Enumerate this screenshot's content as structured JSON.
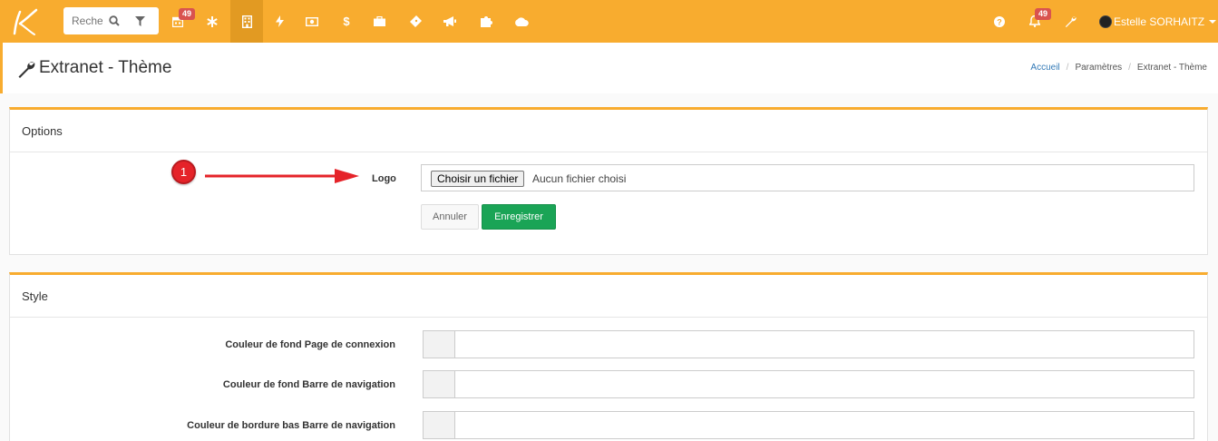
{
  "topbar": {
    "search": {
      "placeholder": "Rechercher"
    },
    "badges": {
      "calendar": "49",
      "notifications": "49"
    },
    "user": {
      "name": "Estelle SORHAITZ"
    },
    "icons": [
      "search-icon",
      "filter-icon",
      "calendar-icon",
      "asterisk-icon",
      "building-icon",
      "bolt-icon",
      "money-icon",
      "dollar-icon",
      "briefcase-icon",
      "ticket-icon",
      "megaphone-icon",
      "puzzle-icon",
      "cloud-icon",
      "help-icon",
      "bell-icon",
      "wrench-icon"
    ]
  },
  "header": {
    "title": "Extranet - Thème",
    "breadcrumb": [
      "Accueil",
      "Paramètres",
      "Extranet - Thème"
    ]
  },
  "options": {
    "heading": "Options",
    "logo_label": "Logo",
    "file_button": "Choisir un fichier",
    "file_status": "Aucun fichier choisi",
    "cancel": "Annuler",
    "save": "Enregistrer"
  },
  "annotation": {
    "marker": "1"
  },
  "style": {
    "heading": "Style",
    "fields": [
      "Couleur de fond Page de connexion",
      "Couleur de fond Barre de navigation",
      "Couleur de bordure bas Barre de navigation"
    ]
  },
  "colors": {
    "accent": "#f8ac2f",
    "success": "#1aa456",
    "badge": "#d9534f",
    "marker": "#e52329"
  }
}
